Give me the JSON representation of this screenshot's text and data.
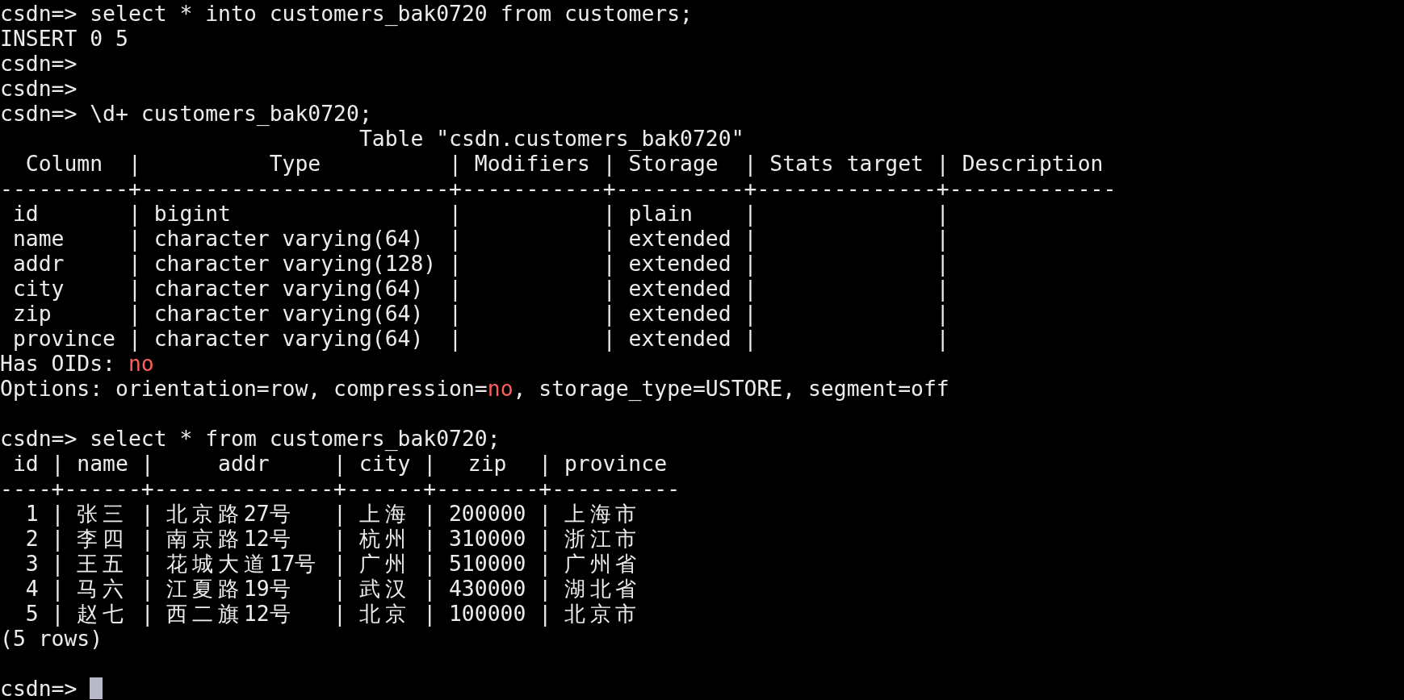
{
  "lines": [
    {
      "kind": "text",
      "segments": [
        {
          "text": "csdn=> select * into customers_bak0720 from customers;",
          "highlight": false
        }
      ]
    },
    {
      "kind": "text",
      "segments": [
        {
          "text": "INSERT 0 5",
          "highlight": false
        }
      ]
    },
    {
      "kind": "text",
      "segments": [
        {
          "text": "csdn=>",
          "highlight": false
        }
      ]
    },
    {
      "kind": "text",
      "segments": [
        {
          "text": "csdn=>",
          "highlight": false
        }
      ]
    },
    {
      "kind": "text",
      "segments": [
        {
          "text": "csdn=> \\d+ customers_bak0720;",
          "highlight": false
        }
      ]
    },
    {
      "kind": "text",
      "segments": [
        {
          "text": "                            Table \"csdn.customers_bak0720\"",
          "highlight": false
        }
      ]
    },
    {
      "kind": "text",
      "segments": [
        {
          "text": "  Column  |          Type          | Modifiers | Storage  | Stats target | Description",
          "highlight": false
        }
      ]
    },
    {
      "kind": "text",
      "segments": [
        {
          "text": "----------+------------------------+-----------+----------+--------------+-------------",
          "highlight": false
        }
      ]
    },
    {
      "kind": "text",
      "segments": [
        {
          "text": " id       | bigint                 |           | plain    |              |",
          "highlight": false
        }
      ]
    },
    {
      "kind": "text",
      "segments": [
        {
          "text": " name     | character varying(64)  |           | extended |              |",
          "highlight": false
        }
      ]
    },
    {
      "kind": "text",
      "segments": [
        {
          "text": " addr     | character varying(128) |           | extended |              |",
          "highlight": false
        }
      ]
    },
    {
      "kind": "text",
      "segments": [
        {
          "text": " city     | character varying(64)  |           | extended |              |",
          "highlight": false
        }
      ]
    },
    {
      "kind": "text",
      "segments": [
        {
          "text": " zip      | character varying(64)  |           | extended |              |",
          "highlight": false
        }
      ]
    },
    {
      "kind": "text",
      "segments": [
        {
          "text": " province | character varying(64)  |           | extended |              |",
          "highlight": false
        }
      ]
    },
    {
      "kind": "text",
      "segments": [
        {
          "text": "Has OIDs: ",
          "highlight": false
        },
        {
          "text": "no",
          "highlight": true
        }
      ]
    },
    {
      "kind": "text",
      "segments": [
        {
          "text": "Options: orientation=row, compression=",
          "highlight": false
        },
        {
          "text": "no",
          "highlight": true
        },
        {
          "text": ", storage_type=USTORE, segment=off",
          "highlight": false
        }
      ]
    },
    {
      "kind": "blank"
    },
    {
      "kind": "text",
      "segments": [
        {
          "text": "csdn=> select * from customers_bak0720;",
          "highlight": false
        }
      ]
    },
    {
      "kind": "table",
      "separator": "|",
      "rule": "----+------+--------------+------+--------+----------",
      "columns": [
        {
          "label": "id",
          "kind": "number"
        },
        {
          "label": "name",
          "kind": "text"
        },
        {
          "label": "addr",
          "kind": "text"
        },
        {
          "label": "city",
          "kind": "text"
        },
        {
          "label": "zip",
          "kind": "text"
        },
        {
          "label": "province",
          "kind": "text"
        }
      ],
      "rows": [
        [
          "1",
          "张三",
          "北京路27号",
          "上海",
          "200000",
          "上海市"
        ],
        [
          "2",
          "李四",
          "南京路12号",
          "杭州",
          "310000",
          "浙江市"
        ],
        [
          "3",
          "王五",
          "花城大道17号",
          "广州",
          "510000",
          "广州省"
        ],
        [
          "4",
          "马六",
          "江夏路19号",
          "武汉",
          "430000",
          "湖北省"
        ],
        [
          "5",
          "赵七",
          "西二旗12号",
          "北京",
          "100000",
          "北京市"
        ]
      ]
    },
    {
      "kind": "text",
      "segments": [
        {
          "text": "(5 rows)",
          "highlight": false
        }
      ]
    },
    {
      "kind": "blank"
    },
    {
      "kind": "prompt",
      "prompt": "csdn=>"
    }
  ]
}
